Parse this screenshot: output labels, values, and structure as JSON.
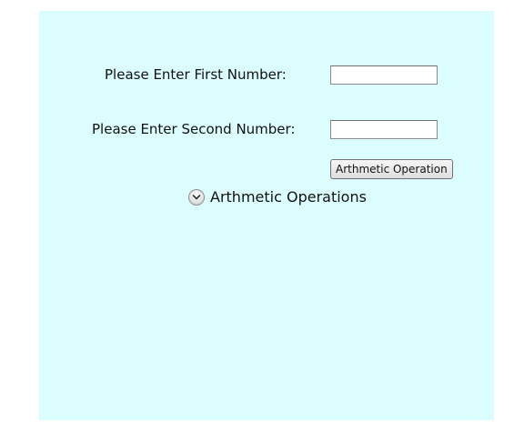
{
  "form": {
    "first_number_label": "Please Enter First Number:",
    "first_number_value": "",
    "second_number_label": "Please Enter Second Number:",
    "second_number_value": "",
    "operation_button_label": "Arthmetic Operation"
  },
  "expander": {
    "label": "Arthmetic Operations",
    "expanded": false,
    "icon": "chevron-down-icon"
  },
  "colors": {
    "panel_background": "#dcfdfd"
  }
}
